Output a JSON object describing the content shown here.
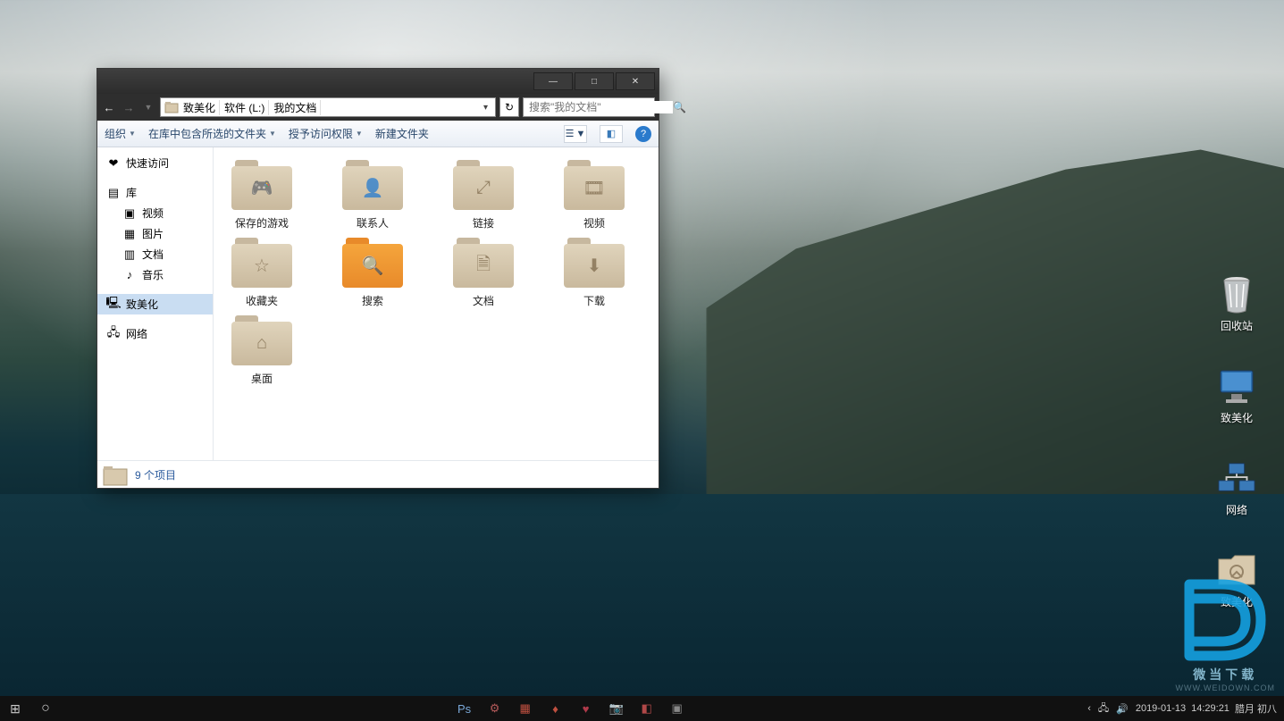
{
  "desktop_icons": [
    {
      "name": "recycle-bin",
      "label": "回收站"
    },
    {
      "name": "themed-pc",
      "label": "致美化"
    },
    {
      "name": "network",
      "label": "网络"
    },
    {
      "name": "themed-folder",
      "label": "致美化"
    }
  ],
  "watermark": {
    "big": "D",
    "title": "微当下载",
    "url": "WWW.WEIDOWN.COM"
  },
  "window": {
    "titlebar": {
      "min": "—",
      "max": "□",
      "close": "✕"
    },
    "address": {
      "segments": [
        "致美化",
        "软件 (L:)",
        "我的文档"
      ],
      "caret": "▾",
      "refresh": "↻"
    },
    "search": {
      "placeholder": "搜索\"我的文档\""
    },
    "toolbar": {
      "organize": "组织",
      "include": "在库中包含所选的文件夹",
      "grant": "授予访问权限",
      "newfolder": "新建文件夹",
      "view_icon": "☰",
      "preview_icon": "◧",
      "help_icon": "?"
    },
    "sidebar": [
      {
        "icon": "❤",
        "label": "快速访问",
        "id": "quick-access",
        "ind": false
      },
      {
        "icon": "▤",
        "label": "库",
        "id": "libraries",
        "ind": false
      },
      {
        "icon": "▣",
        "label": "视频",
        "id": "lib-video",
        "ind": true
      },
      {
        "icon": "▦",
        "label": "图片",
        "id": "lib-pictures",
        "ind": true
      },
      {
        "icon": "▥",
        "label": "文档",
        "id": "lib-documents",
        "ind": true
      },
      {
        "icon": "♪",
        "label": "音乐",
        "id": "lib-music",
        "ind": true
      },
      {
        "icon": "🖳",
        "label": "致美化",
        "id": "this-pc",
        "ind": false,
        "sel": true
      },
      {
        "icon": "🖧",
        "label": "网络",
        "id": "network",
        "ind": false
      }
    ],
    "items": [
      {
        "label": "保存的游戏",
        "sym": "🎮",
        "id": "saved-games"
      },
      {
        "label": "联系人",
        "sym": "👤",
        "id": "contacts"
      },
      {
        "label": "链接",
        "sym": "⤢",
        "id": "links"
      },
      {
        "label": "视频",
        "sym": "🎞",
        "id": "videos"
      },
      {
        "label": "收藏夹",
        "sym": "☆",
        "id": "favorites"
      },
      {
        "label": "搜索",
        "sym": "🔍",
        "id": "searches",
        "orange": true
      },
      {
        "label": "文档",
        "sym": "🗎",
        "id": "documents"
      },
      {
        "label": "下载",
        "sym": "⬇",
        "id": "downloads"
      },
      {
        "label": "桌面",
        "sym": "⌂",
        "id": "desktop"
      }
    ],
    "status": "9 个项目"
  },
  "taskbar": {
    "start": "⊞",
    "search": "○",
    "apps": [
      {
        "id": "ps",
        "label": "Ps",
        "color": "#7aa8d8"
      },
      {
        "id": "gear",
        "label": "⚙",
        "color": "#b45a5a"
      },
      {
        "id": "grid",
        "label": "▦",
        "color": "#c05040"
      },
      {
        "id": "jd",
        "label": "♦",
        "color": "#c05040"
      },
      {
        "id": "heart",
        "label": "♥",
        "color": "#b03a4a"
      },
      {
        "id": "camera",
        "label": "📷",
        "color": "#aaa"
      },
      {
        "id": "app7",
        "label": "◧",
        "color": "#b04848"
      },
      {
        "id": "app8",
        "label": "▣",
        "color": "#888"
      }
    ],
    "tray": {
      "arrow": "‹",
      "net": "🖧",
      "vol": "🔊"
    },
    "clock": {
      "date": "2019-01-13",
      "time": "14:29:21",
      "lunar": "腊月 初八"
    }
  }
}
